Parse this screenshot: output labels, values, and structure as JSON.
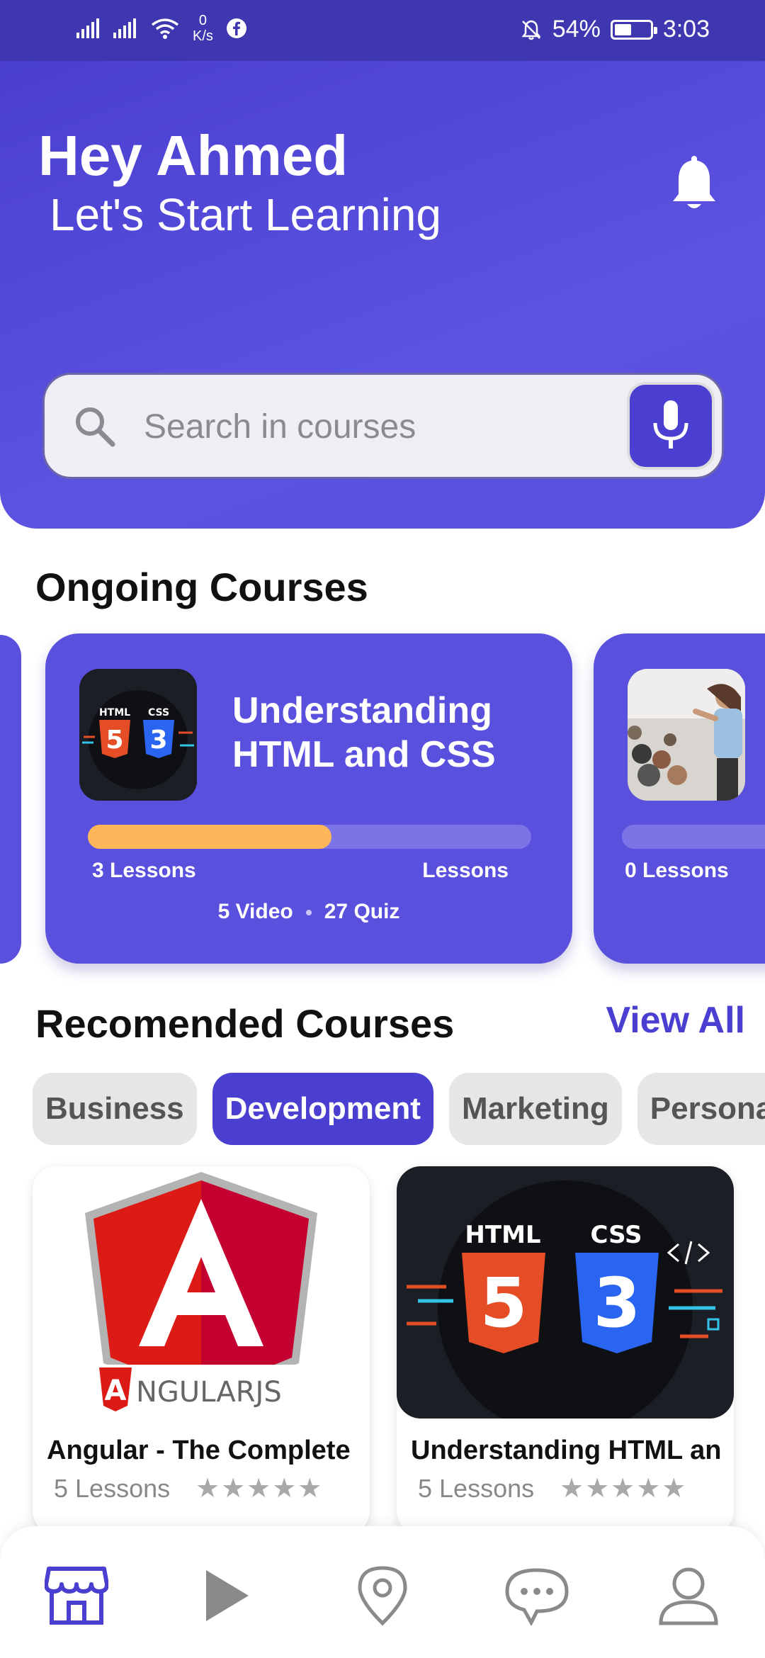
{
  "status_bar": {
    "net_speed_value": "0",
    "net_speed_unit": "K/s",
    "battery": "54%",
    "battery_level": 0.54,
    "time": "3:03"
  },
  "header": {
    "greeting": "Hey Ahmed",
    "subtitle": "Let's Start Learning"
  },
  "search": {
    "placeholder": "Search in courses",
    "value": ""
  },
  "ongoing": {
    "title": "Ongoing Courses",
    "cards": [
      {
        "title_line1": "Understanding",
        "title_line2": "HTML and CSS",
        "progress": 0.55,
        "lessons_left": "3 Lessons",
        "lessons_right": "Lessons",
        "videos": "5 Video",
        "quizzes": "27 Quiz"
      },
      {
        "lessons_left": "0 Lessons",
        "progress": 0.0
      }
    ]
  },
  "recommended": {
    "title": "Recomended Courses",
    "view_all": "View All",
    "categories": [
      "Business",
      "Development",
      "Marketing",
      "Personal D"
    ],
    "active_category": "Development",
    "courses": [
      {
        "title": "Angular - The Complete ...",
        "lessons": "5 Lessons",
        "stars": "★★★★★",
        "logo_text": "NGULARJS",
        "logo_letter": "A"
      },
      {
        "title": "Understanding HTML an...",
        "lessons": "5 Lessons",
        "stars": "★★★★★",
        "logo_html": "HTML",
        "logo_css": "CSS",
        "logo_5": "5",
        "logo_3": "3"
      }
    ]
  },
  "thumb_logo": {
    "html": "HTML",
    "css": "CSS",
    "five": "5",
    "three": "3"
  },
  "colors": {
    "primary": "#5a50de",
    "accent_dark": "#4a3fd0",
    "progress": "#fdb75a"
  }
}
